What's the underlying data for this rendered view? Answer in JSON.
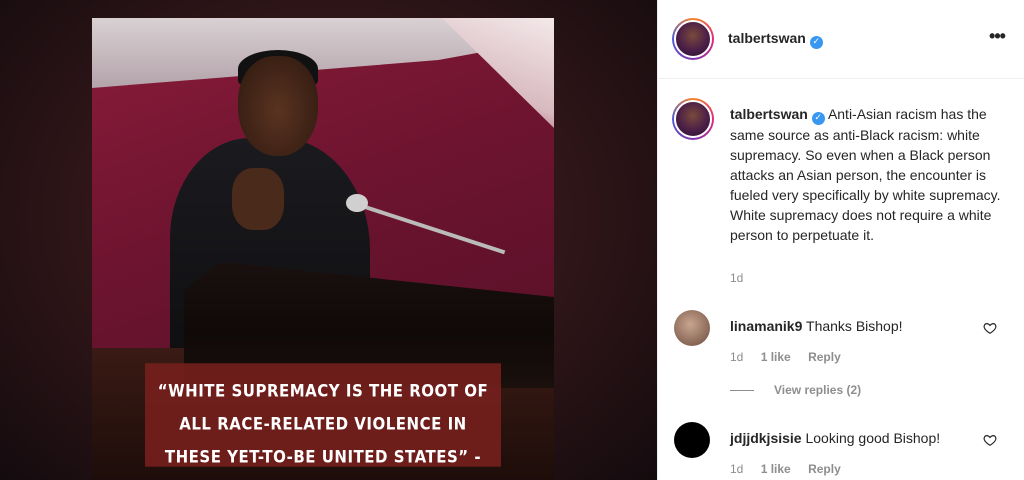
{
  "post": {
    "author": "talbertswan",
    "verified_mark": "✓",
    "more_icon": "more-horizontal-icon",
    "image_quote": "“WHITE SUPREMACY IS THE ROOT OF ALL RACE-RELATED VIOLENCE IN THESE YET-TO-BE UNITED STATES” - @TALBERTSWAN"
  },
  "caption": {
    "user": "talbertswan",
    "text": "Anti-Asian racism has the same source as anti-Black racism: white supremacy. So even when a Black person attacks an Asian person, the encounter is fueled very specifically by white supremacy. White supremacy does not require a white person to perpetuate it.",
    "time": "1d"
  },
  "comments": [
    {
      "user": "linamanik9",
      "text": "Thanks Bishop!",
      "time": "1d",
      "likes": "1 like",
      "reply_label": "Reply",
      "avatar_color": "#9a7866"
    },
    {
      "user": "jdjjdkjsisie",
      "text": "Looking good Bishop!",
      "time": "1d",
      "likes": "1 like",
      "reply_label": "Reply",
      "avatar_color": "#000000"
    }
  ],
  "view_replies": "View replies (2)"
}
